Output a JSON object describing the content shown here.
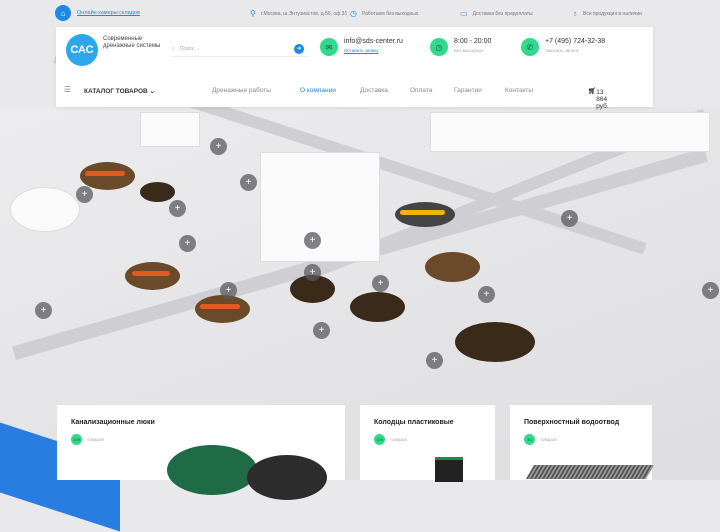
{
  "topbar": {
    "cameras_link": "Онлайн камеры складов",
    "address": "г.Москва, ш.Энтузиастов, д.56, оф.31",
    "hours": "Работаем без выходных",
    "delivery": "Доставка без предоплаты",
    "stock": "Вся продукция в наличии"
  },
  "header": {
    "logo": "САС",
    "logo_text": "Современные дренажные системы",
    "search_placeholder": "Поиск ...",
    "email": "info@sds-center.ru",
    "email_sub": "Оставить заявку",
    "time": "8:00 - 20:00",
    "time_sub": "Без выходных",
    "phone": "+7 (495) 724-32-38",
    "phone_sub": "Заказать звонок"
  },
  "nav": {
    "catalog": "КАТАЛОГ ТОВАРОВ",
    "items": [
      "Дренажные работы",
      "О компании",
      "Доставка",
      "Оплата",
      "Гарантии",
      "Контакты"
    ],
    "cart_total": "13 864 руб."
  },
  "cards": [
    {
      "title": "Канализационные люки",
      "count": "109",
      "unit": "товаров"
    },
    {
      "title": "Колодцы пластиковые",
      "count": "105",
      "unit": "товаров"
    },
    {
      "title": "Поверхностный водоотвод",
      "count": "33",
      "unit": "товаров"
    }
  ],
  "marker_symbol": "+",
  "colors": {
    "accent": "#1e88e5",
    "green": "#33d98a"
  }
}
